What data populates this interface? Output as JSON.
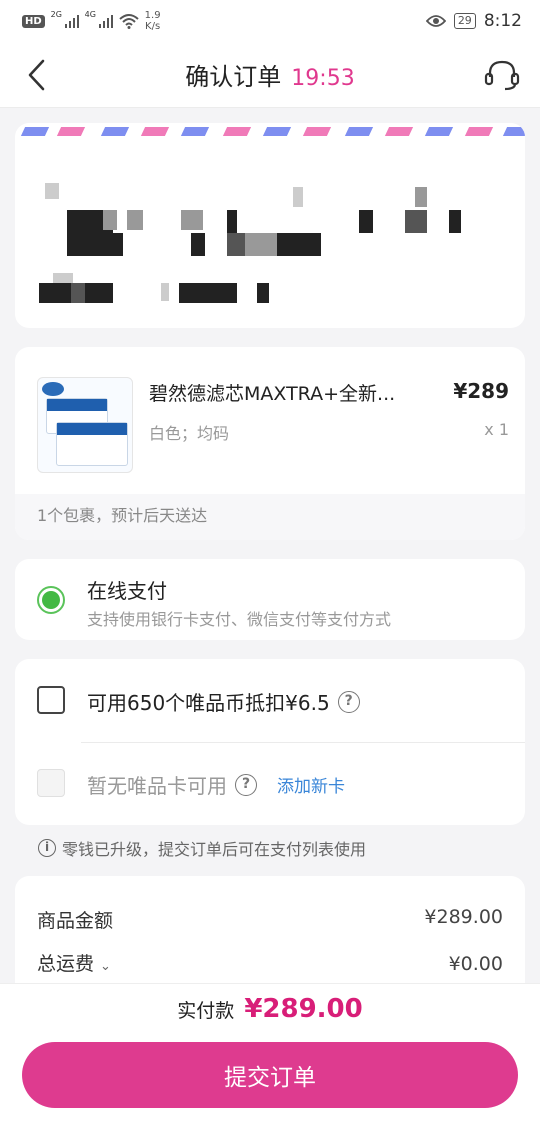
{
  "status_bar": {
    "hd_badge": "HD",
    "network_1": "2G",
    "network_2": "4G",
    "speed": "1.9",
    "speed_unit": "K/s",
    "battery": "29",
    "time": "8:12"
  },
  "header": {
    "title": "确认订单",
    "countdown": "19:53"
  },
  "product": {
    "name": "碧然德滤芯MAXTRA+全新...",
    "price": "¥289",
    "spec": "白色；均码",
    "quantity": "x 1",
    "delivery": "1个包裹，预计后天送达"
  },
  "payment": {
    "title": "在线支付",
    "description": "支持使用银行卡支付、微信支付等支付方式",
    "selected": true
  },
  "discounts": {
    "coin_label": "可用650个唯品币抵扣¥6.5",
    "coin_checked": false,
    "card_label": "暂无唯品卡可用",
    "add_card": "添加新卡",
    "help": "?"
  },
  "notice": {
    "icon": "i",
    "text": "零钱已升级，提交订单后可在支付列表使用"
  },
  "summary": {
    "goods_label": "商品金额",
    "goods_value": "¥289.00",
    "shipping_label": "总运费",
    "shipping_value": "¥0.00"
  },
  "footer": {
    "total_label": "实付款",
    "total_amount": "¥289.00",
    "submit_label": "提交订单"
  },
  "colors": {
    "accent": "#de3b8f",
    "price_accent": "#d81e78",
    "selected_green": "#43b944",
    "link_blue": "#3a86d8"
  }
}
